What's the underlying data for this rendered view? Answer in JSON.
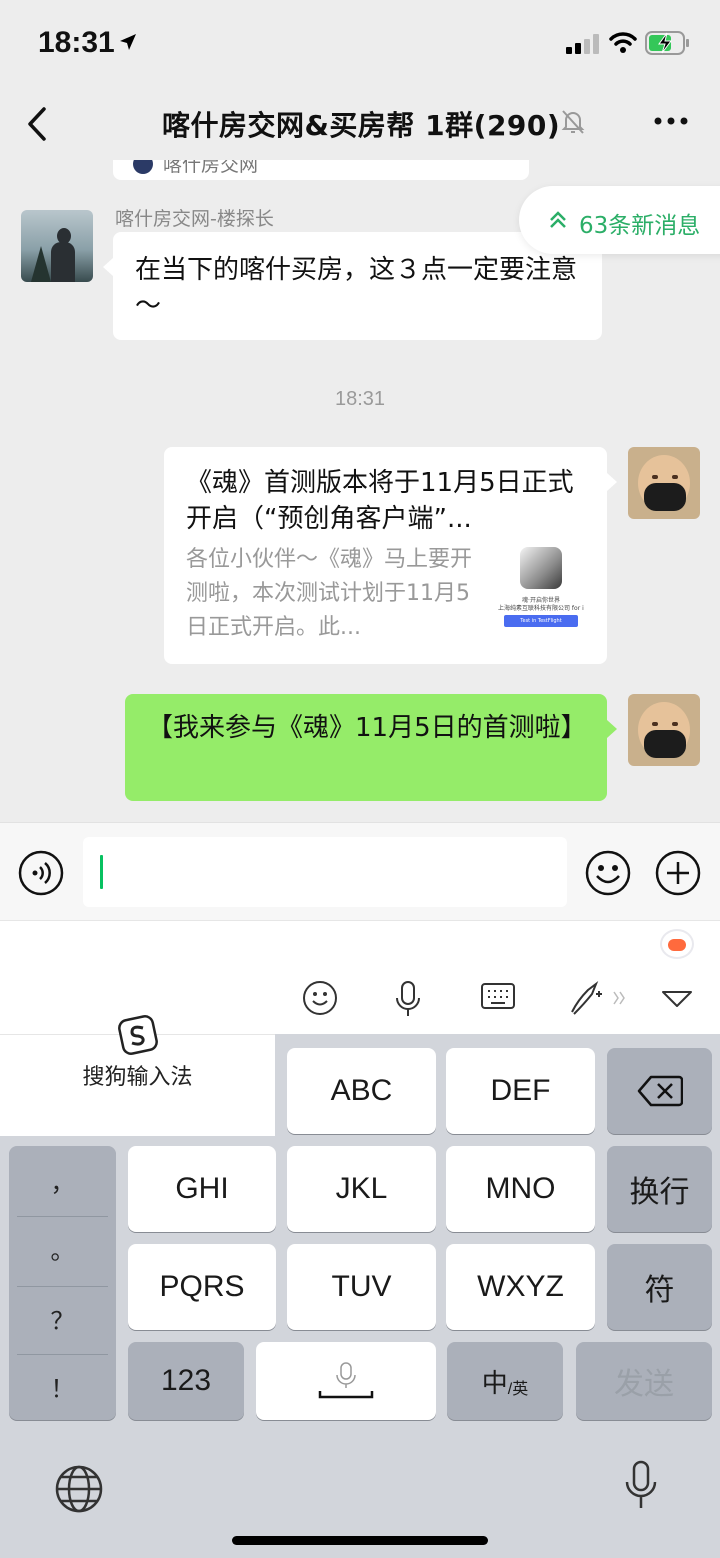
{
  "status_bar": {
    "time": "18:31",
    "icons": [
      "location-arrow-icon",
      "signal-icon",
      "wifi-icon",
      "battery-charging-icon"
    ]
  },
  "nav": {
    "title": "喀什房交网&买房帮 1群(290)",
    "icons": [
      "back-icon",
      "muted-bell-icon",
      "more-icon"
    ]
  },
  "chat": {
    "prev_card_text": "喀什房交网",
    "new_messages": "63条新消息",
    "msg1": {
      "sender": "喀什房交网-楼探长",
      "text": "在当下的喀什买房，这３点一定要注意～"
    },
    "timestamp": "18:31",
    "card": {
      "title": "《魂》首测版本将于11月5日正式开启（“预创角客户端”...",
      "desc": "各位小伙伴～《魂》马上要开测啦，本次测试计划于11月5日正式开启。此...",
      "thumb_line1": "魂·开启你世界",
      "thumb_line2": "上海纯素互联科技有限公司 for iOS",
      "thumb_button": "Test in TestFlight"
    },
    "msg2": {
      "text": "【我来参与《魂》11月5日的首测啦】"
    }
  },
  "input": {
    "value": ""
  },
  "keyboard": {
    "brand": "搜狗输入法",
    "toolbar_icons": [
      "smiley-icon",
      "microphone-icon",
      "keyboard-icon",
      "handwriting-icon",
      "collapse-icon"
    ],
    "punct": [
      "，",
      "。",
      "？",
      "！"
    ],
    "keys": {
      "abc": "ABC",
      "def": "DEF",
      "ghi": "GHI",
      "jkl": "JKL",
      "mno": "MNO",
      "enter": "换行",
      "pqrs": "PQRS",
      "tuv": "TUV",
      "wxyz": "WXYZ",
      "symbol": "符",
      "num": "123",
      "lang_main": "中",
      "lang_sub": "/英",
      "send": "发送"
    }
  },
  "colors": {
    "wechat_green": "#07c160",
    "bubble_green": "#95ec69",
    "newmsg_green": "#2bae67",
    "chat_bg": "#ededed"
  }
}
